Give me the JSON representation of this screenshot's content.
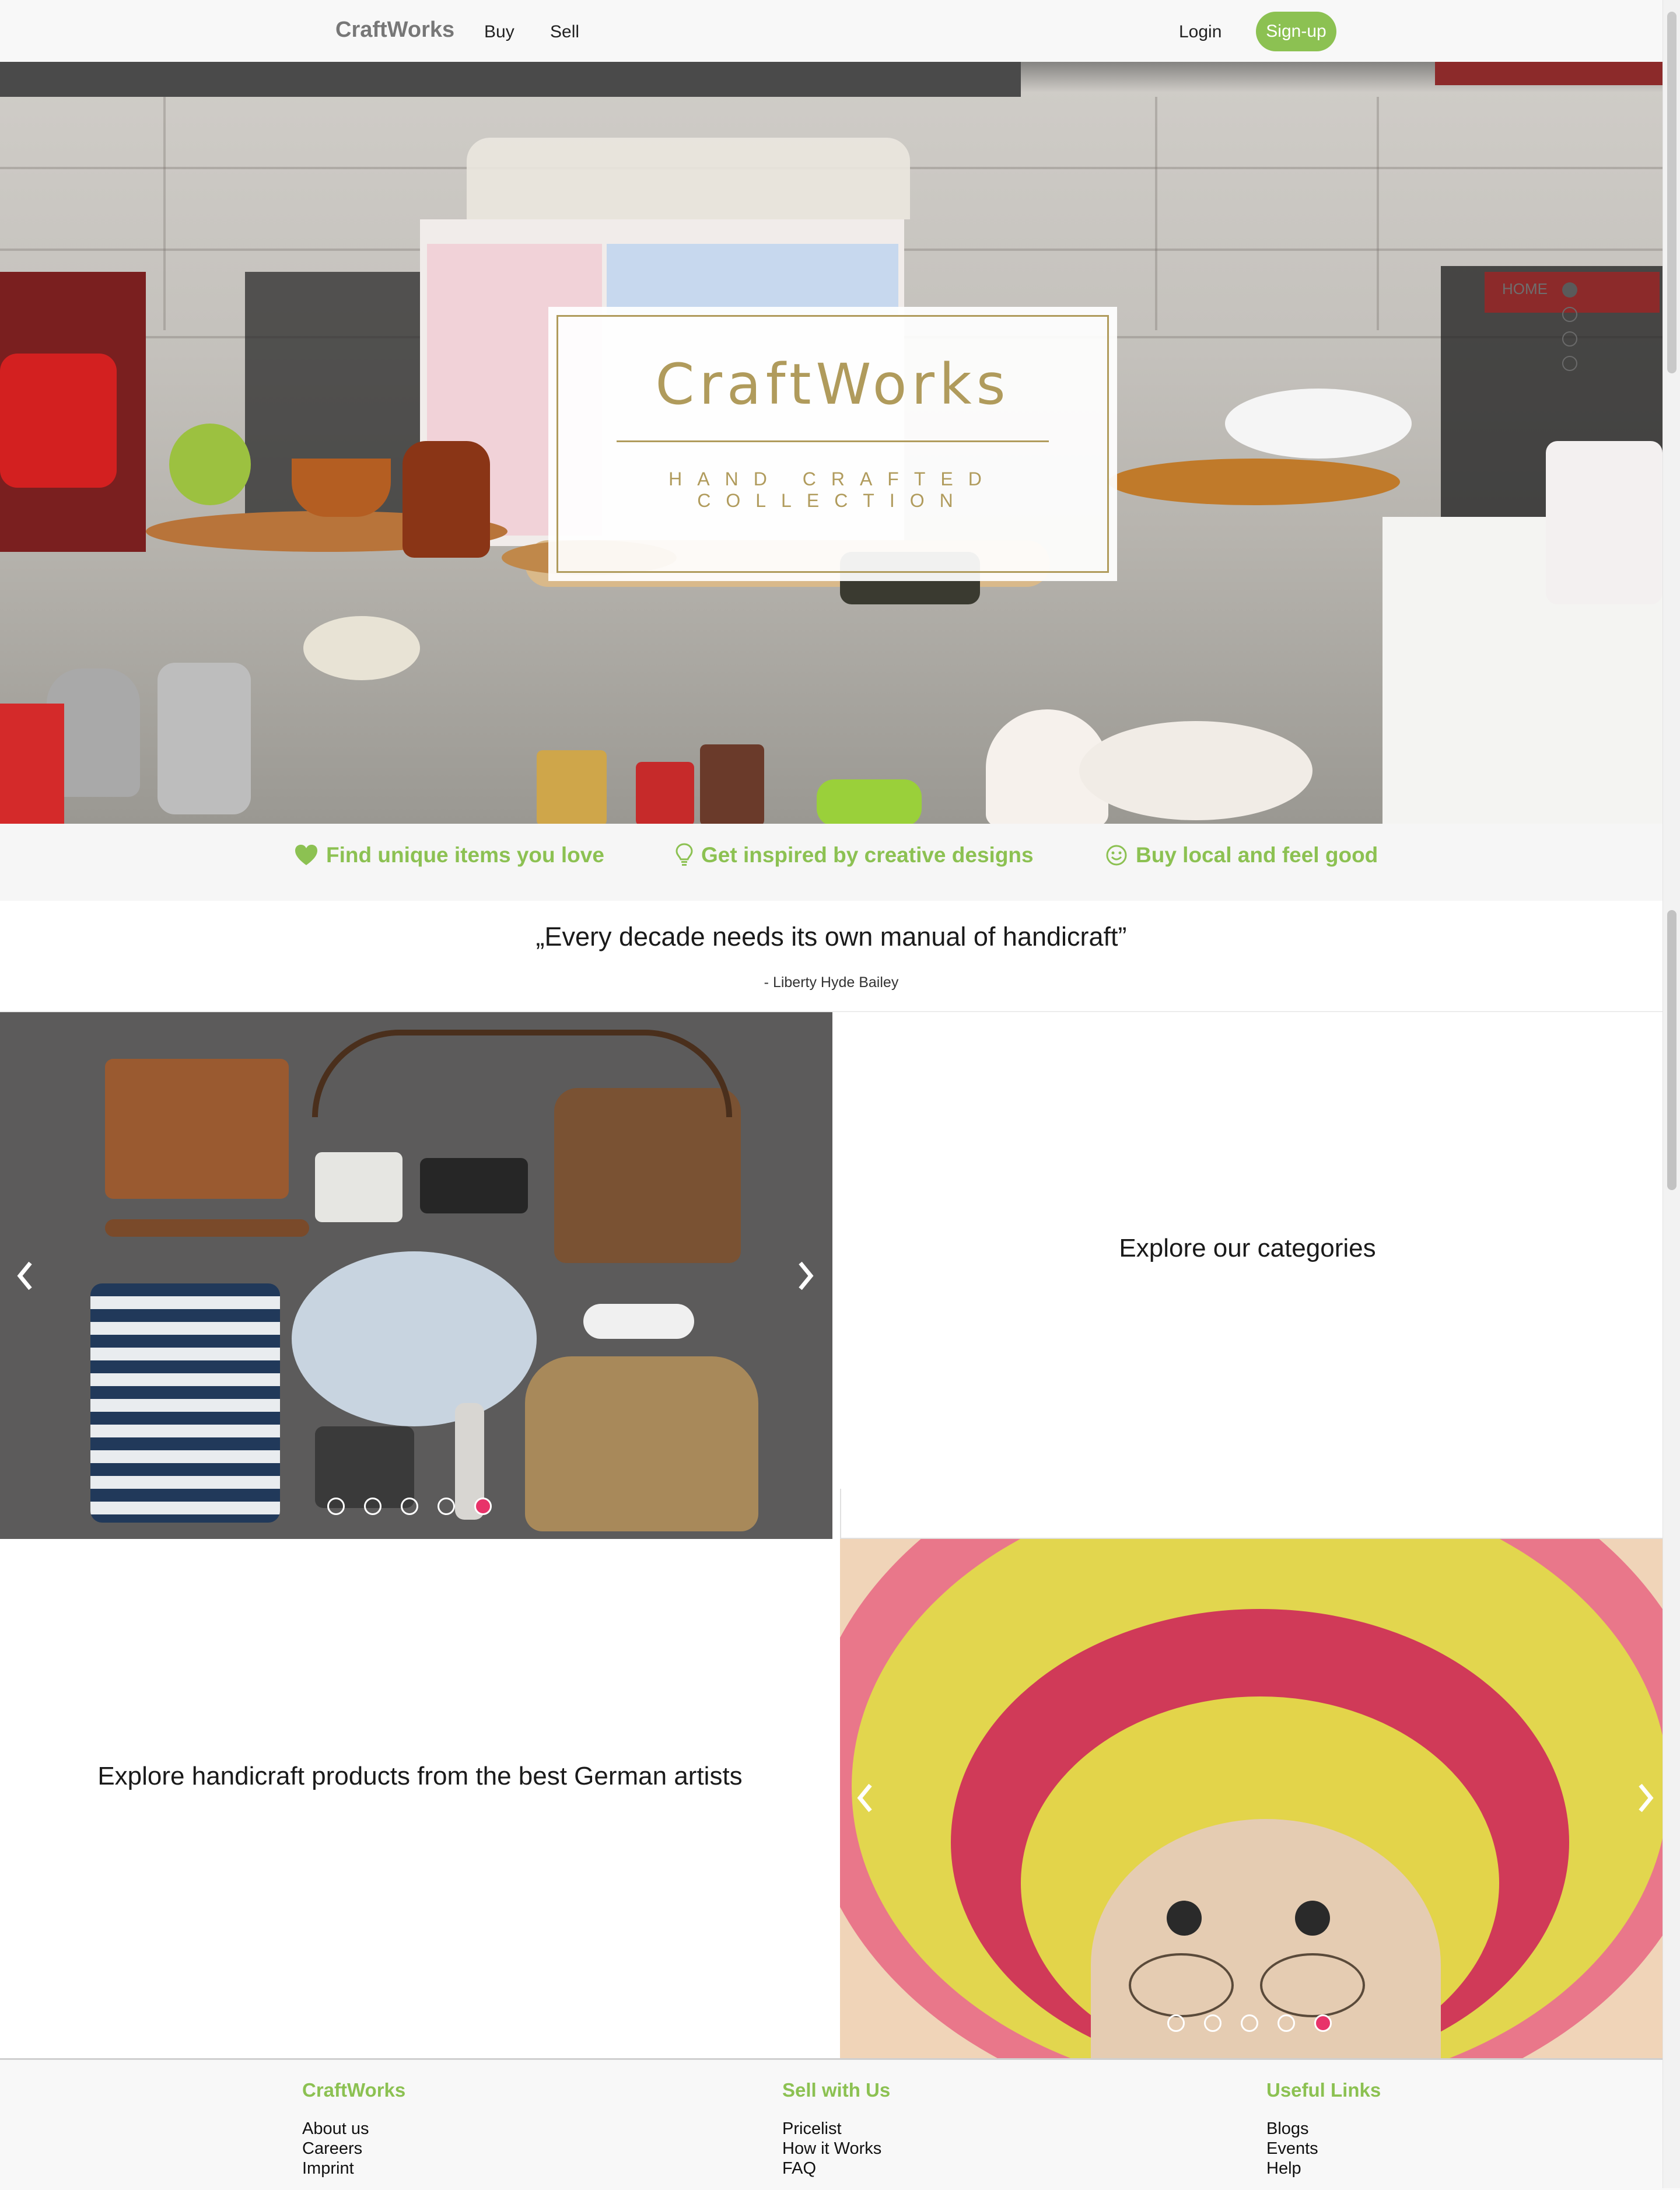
{
  "navbar": {
    "brand": "CraftWorks",
    "links": [
      {
        "label": "Buy"
      },
      {
        "label": "Sell"
      }
    ],
    "login": "Login",
    "signup": "Sign-up"
  },
  "hero": {
    "title": "CraftWorks",
    "subtitle": "HAND CRAFTED COLLECTION",
    "side_nav_label": "HOME"
  },
  "features": [
    {
      "icon": "heart-icon",
      "label": "Find unique items you love"
    },
    {
      "icon": "lightbulb-icon",
      "label": "Get inspired by creative designs"
    },
    {
      "icon": "smiley-icon",
      "label": "Buy local and feel good"
    }
  ],
  "quote": {
    "text": "„Every decade needs its own manual of handicraft”",
    "author": "- Liberty Hyde Bailey"
  },
  "categories": {
    "text": "Explore our categories",
    "slider_active": 5,
    "slider_count": 5
  },
  "artists": {
    "text": "Explore handicraft products from the best German artists",
    "slider_active": 5,
    "slider_count": 5
  },
  "footer": {
    "columns": [
      {
        "heading": "CraftWorks",
        "links": [
          "About us",
          "Careers",
          "Imprint"
        ]
      },
      {
        "heading": "Sell with Us",
        "links": [
          "Pricelist",
          "How it Works",
          "FAQ"
        ]
      },
      {
        "heading": "Useful Links",
        "links": [
          "Blogs",
          "Events",
          "Help"
        ]
      }
    ]
  },
  "colors": {
    "accent_green": "#8cc152",
    "hero_gold": "#b09b5c",
    "active_dot": "#e8336a"
  }
}
